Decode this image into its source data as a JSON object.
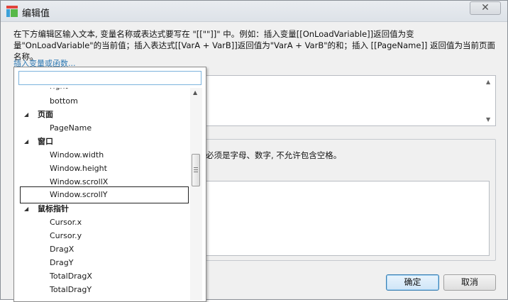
{
  "window": {
    "title": "编辑值",
    "close_glyph": "✕"
  },
  "instructions": "在下方编辑区输入文本, 变量名称或表达式要写在 \"[[\"\"]]\" 中。例如：插入变量[[OnLoadVariable]]返回值为变量\"OnLoadVariable\"的当前值；插入表达式[[VarA + VarB]]返回值为\"VarA + VarB\"的和；插入 [[PageName]] 返回值为当前页面名称。",
  "insert_link": "插入变量或函数...",
  "group_text": "必须是字母、数字, 不允许包含空格。",
  "buttons": {
    "ok": "确定",
    "cancel": "取消"
  },
  "popup": {
    "search_value": "",
    "cut_top_item": "right",
    "tree": [
      {
        "type": "item",
        "label": "bottom"
      },
      {
        "type": "category",
        "label": "页面"
      },
      {
        "type": "item",
        "label": "PageName"
      },
      {
        "type": "category",
        "label": "窗口"
      },
      {
        "type": "item",
        "label": "Window.width"
      },
      {
        "type": "item",
        "label": "Window.height"
      },
      {
        "type": "item",
        "label": "Window.scrollX"
      },
      {
        "type": "item",
        "label": "Window.scrollY",
        "selected": true
      },
      {
        "type": "category",
        "label": "鼠标指针"
      },
      {
        "type": "item",
        "label": "Cursor.x"
      },
      {
        "type": "item",
        "label": "Cursor.y"
      },
      {
        "type": "item",
        "label": "DragX"
      },
      {
        "type": "item",
        "label": "DragY"
      },
      {
        "type": "item",
        "label": "TotalDragX"
      },
      {
        "type": "item",
        "label": "TotalDragY"
      }
    ]
  },
  "icons": {
    "app": "app-logo-icon",
    "expand": "expand-arrow-icon",
    "scroll_up": "scroll-up-arrow-icon",
    "scroll_down": "scroll-down-arrow-icon"
  },
  "colors": {
    "link": "#2e7ab5",
    "focus_border": "#7cb3dd",
    "ok_border": "#3c7fb1"
  }
}
